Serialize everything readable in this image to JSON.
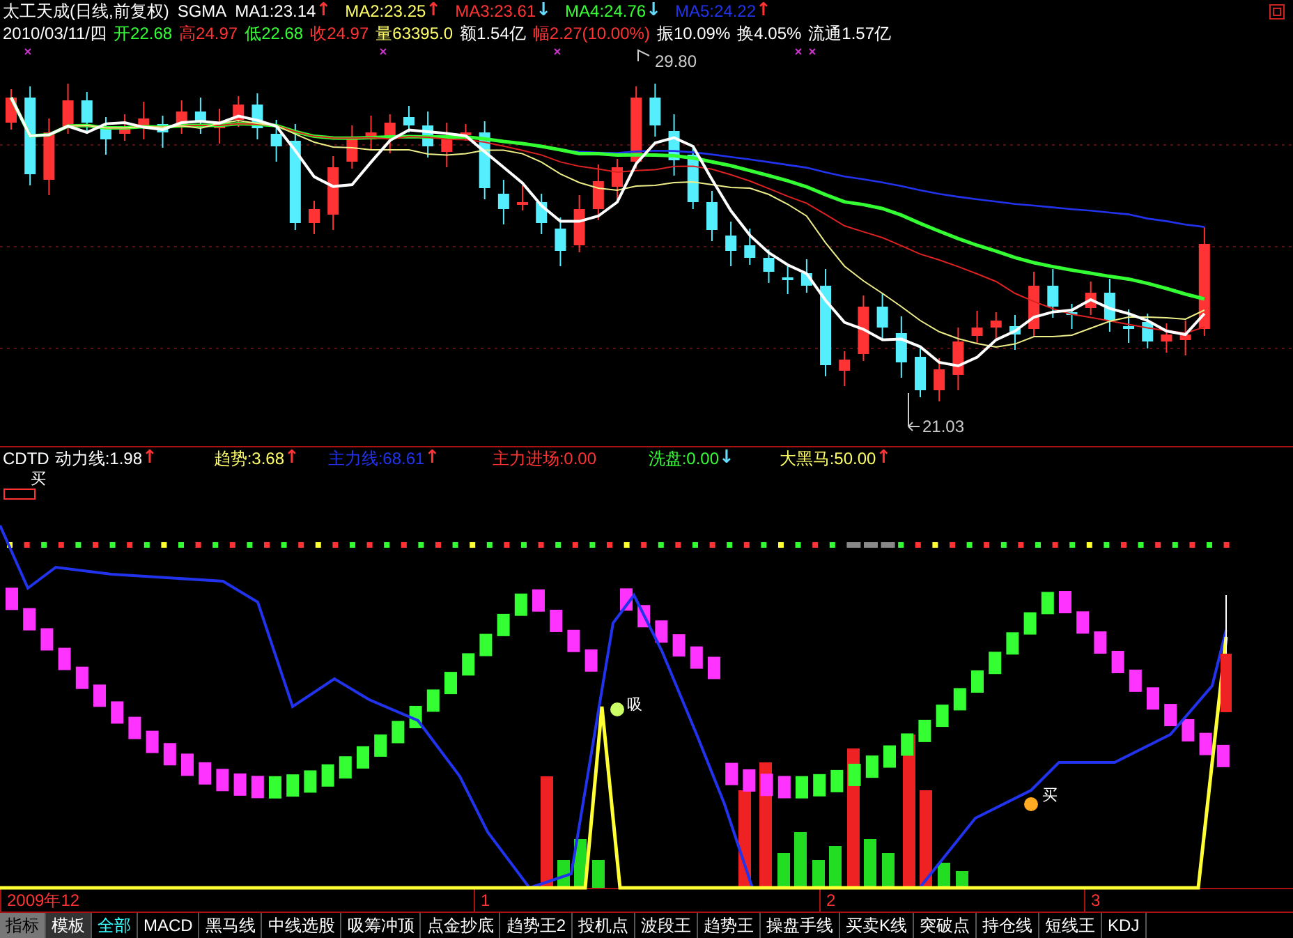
{
  "window": {
    "title": "太工天成(日线,前复权)"
  },
  "header": {
    "indicator": "SGMA",
    "mas": [
      {
        "label": "MA1:23.14",
        "color": "#ffffff",
        "arrow": {
          "text": "↑",
          "color": "#ff3333"
        }
      },
      {
        "label": "MA2:23.25",
        "color": "#ffff66",
        "arrow": {
          "text": "↑",
          "color": "#ff3333"
        }
      },
      {
        "label": "MA3:23.61",
        "color": "#ff3333",
        "arrow": {
          "text": "↓",
          "color": "#66ddff"
        }
      },
      {
        "label": "MA4:24.76",
        "color": "#33ff33",
        "arrow": {
          "text": "↓",
          "color": "#66ddff"
        }
      },
      {
        "label": "MA5:24.22",
        "color": "#2233ee",
        "arrow": {
          "text": "↑",
          "color": "#ff3333"
        }
      }
    ]
  },
  "quote": {
    "date": "2010/03/11/四",
    "items": [
      {
        "text": "开22.68",
        "color": "#33ff33"
      },
      {
        "text": "高24.97",
        "color": "#ff3333"
      },
      {
        "text": "低22.68",
        "color": "#33ff33"
      },
      {
        "text": "收24.97",
        "color": "#ff3333"
      },
      {
        "text": "量63395.0",
        "color": "#ffff66"
      },
      {
        "text": "额1.54亿",
        "color": "#ffffff"
      },
      {
        "text": "幅2.27(10.00%)",
        "color": "#ff3333"
      },
      {
        "text": "振10.09%",
        "color": "#ffffff"
      },
      {
        "text": "换4.05%",
        "color": "#ffffff"
      },
      {
        "text": "流通1.57亿",
        "color": "#ffffff"
      }
    ]
  },
  "main_chart": {
    "high_label": "29.80",
    "low_label": "21.03"
  },
  "sub_chart": {
    "name": "CDTD",
    "lines": [
      {
        "label": "动力线:1.98",
        "color": "#ffffff",
        "arrow": {
          "text": "↑",
          "color": "#ff3333"
        }
      },
      {
        "label": "趋势:3.68",
        "color": "#ffff66",
        "arrow": {
          "text": "↑",
          "color": "#ff3333"
        }
      },
      {
        "label": "主力线:68.61",
        "color": "#2233ee",
        "arrow": {
          "text": "↑",
          "color": "#ff3333"
        }
      },
      {
        "label": "主力进场:0.00",
        "color": "#ff3333"
      },
      {
        "label": "洗盘:0.00",
        "color": "#33ff33",
        "arrow": {
          "text": "↓",
          "color": "#66ddff"
        }
      },
      {
        "label": "大黑马:50.00",
        "color": "#ffff66",
        "arrow": {
          "text": "↑",
          "color": "#ff3333"
        }
      }
    ],
    "signals": [
      {
        "text": "买"
      },
      {
        "text": "吸"
      },
      {
        "text": "买"
      }
    ]
  },
  "date_axis": [
    "2009年12",
    "1",
    "2",
    "3"
  ],
  "tabs": [
    {
      "label": "指标",
      "kind": "mode",
      "selected": true
    },
    {
      "label": "模板",
      "kind": "mode",
      "selected": false
    },
    {
      "label": "全部",
      "kind": "tab",
      "selected": true
    },
    {
      "label": "MACD",
      "kind": "tab",
      "selected": false
    },
    {
      "label": "黑马线",
      "kind": "tab",
      "selected": false
    },
    {
      "label": "中线选股",
      "kind": "tab",
      "selected": false
    },
    {
      "label": "吸筹冲顶",
      "kind": "tab",
      "selected": false
    },
    {
      "label": "点金抄底",
      "kind": "tab",
      "selected": false
    },
    {
      "label": "趋势王2",
      "kind": "tab",
      "selected": false
    },
    {
      "label": "投机点",
      "kind": "tab",
      "selected": false
    },
    {
      "label": "波段王",
      "kind": "tab",
      "selected": false
    },
    {
      "label": "趋势王",
      "kind": "tab",
      "selected": false
    },
    {
      "label": "操盘手线",
      "kind": "tab",
      "selected": false
    },
    {
      "label": "买卖K线",
      "kind": "tab",
      "selected": false
    },
    {
      "label": "突破点",
      "kind": "tab",
      "selected": false
    },
    {
      "label": "持仓线",
      "kind": "tab",
      "selected": false
    },
    {
      "label": "短线王",
      "kind": "tab",
      "selected": false
    },
    {
      "label": "KDJ",
      "kind": "tab",
      "selected": false
    }
  ]
}
